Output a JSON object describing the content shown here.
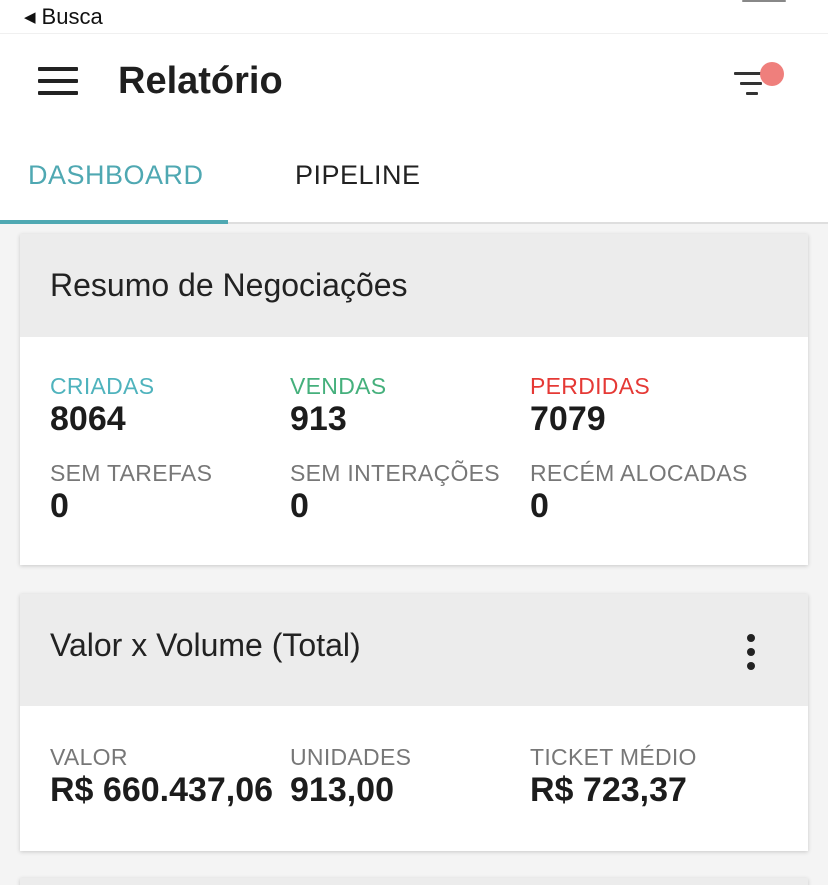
{
  "statusbar": {
    "back_label": "Busca",
    "back_glyph": "◀"
  },
  "appbar": {
    "title": "Relatório",
    "menu_icon": "hamburger-menu-icon",
    "filter_icon": "filter-icon",
    "filter_badge_color": "#ef7f7c"
  },
  "tabs": [
    {
      "label": "DASHBOARD",
      "active": true
    },
    {
      "label": "PIPELINE",
      "active": false
    }
  ],
  "accent_color": "#4fa8b2",
  "summary": {
    "title": "Resumo de Negociações",
    "row1": [
      {
        "label": "CRIADAS",
        "value": "8064",
        "color": "#4fb3bd"
      },
      {
        "label": "VENDAS",
        "value": "913",
        "color": "#45b07c"
      },
      {
        "label": "PERDIDAS",
        "value": "7079",
        "color": "#e53935"
      }
    ],
    "row2": [
      {
        "label": "SEM TAREFAS",
        "value": "0"
      },
      {
        "label": "SEM INTERAÇÕES",
        "value": "0"
      },
      {
        "label": "RECÉM ALOCADAS",
        "value": "0"
      }
    ]
  },
  "volume": {
    "title": "Valor x Volume (Total)",
    "more_icon": "more-vertical-icon",
    "stats": [
      {
        "label": "VALOR",
        "value": "R$ 660.437,06"
      },
      {
        "label": "UNIDADES",
        "value": "913,00"
      },
      {
        "label": "TICKET MÉDIO",
        "value": "R$ 723,37"
      }
    ]
  }
}
